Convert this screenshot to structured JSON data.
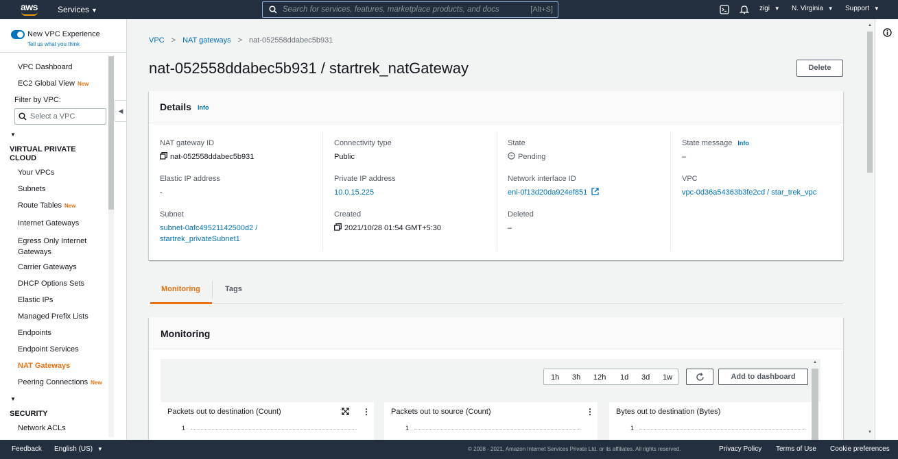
{
  "topnav": {
    "logo": "aws",
    "services_label": "Services",
    "search_placeholder": "Search for services, features, marketplace products, and docs",
    "search_shortcut": "[Alt+S]",
    "user": "zigi",
    "region": "N. Virginia",
    "support": "Support",
    "icons": [
      "cloudshell-icon",
      "bell-icon"
    ]
  },
  "sidenav": {
    "vpc_experience": "New VPC Experience",
    "vpc_experience_sub": "Tell us what you think",
    "top_items": [
      {
        "label": "VPC Dashboard"
      },
      {
        "label": "EC2 Global View",
        "badge": "New"
      }
    ],
    "filter_label": "Filter by VPC:",
    "filter_placeholder": "Select a VPC",
    "section_vpc": "VIRTUAL PRIVATE CLOUD",
    "vpc_items": [
      {
        "label": "Your VPCs"
      },
      {
        "label": "Subnets"
      },
      {
        "label": "Route Tables",
        "badge": "New"
      },
      {
        "label": "Internet Gateways"
      },
      {
        "label": "Egress Only Internet Gateways"
      },
      {
        "label": "Carrier Gateways"
      },
      {
        "label": "DHCP Options Sets"
      },
      {
        "label": "Elastic IPs"
      },
      {
        "label": "Managed Prefix Lists"
      },
      {
        "label": "Endpoints"
      },
      {
        "label": "Endpoint Services"
      },
      {
        "label": "NAT Gateways",
        "active": true
      },
      {
        "label": "Peering Connections",
        "badge": "New"
      }
    ],
    "section_security": "SECURITY",
    "security_items": [
      {
        "label": "Network ACLs"
      }
    ]
  },
  "breadcrumb": {
    "items": [
      "VPC",
      "NAT gateways"
    ],
    "current": "nat-052558ddabec5b931"
  },
  "page": {
    "title": "nat-052558ddabec5b931 / startrek_natGateway",
    "delete_label": "Delete"
  },
  "details": {
    "heading": "Details",
    "info": "Info",
    "nat_gateway_id_label": "NAT gateway ID",
    "nat_gateway_id": "nat-052558ddabec5b931",
    "elastic_ip_label": "Elastic IP address",
    "elastic_ip": "-",
    "subnet_label": "Subnet",
    "subnet_line1": "subnet-0afc49521142500d2 /",
    "subnet_line2": "startrek_privateSubnet1",
    "connectivity_label": "Connectivity type",
    "connectivity": "Public",
    "private_ip_label": "Private IP address",
    "private_ip": "10.0.15.225",
    "created_label": "Created",
    "created": "2021/10/28 01:54 GMT+5:30",
    "state_label": "State",
    "state": "Pending",
    "eni_label": "Network interface ID",
    "eni": "eni-0f13d20da924ef851",
    "deleted_label": "Deleted",
    "deleted": "–",
    "state_message_label": "State message",
    "state_message_info": "Info",
    "state_message": "–",
    "vpc_label": "VPC",
    "vpc": "vpc-0d36a54363b3fe2cd / star_trek_vpc"
  },
  "tabs": [
    {
      "label": "Monitoring",
      "active": true
    },
    {
      "label": "Tags"
    }
  ],
  "monitoring": {
    "heading": "Monitoring",
    "ranges": [
      "1h",
      "3h",
      "12h",
      "1d",
      "3d",
      "1w"
    ],
    "add_dashboard": "Add to dashboard",
    "widgets": [
      {
        "title": "Packets out to destination (Count)",
        "tick": "1"
      },
      {
        "title": "Packets out to source (Count)",
        "tick": "1"
      },
      {
        "title": "Bytes out to destination (Bytes)",
        "tick": "1"
      }
    ]
  },
  "footer": {
    "feedback": "Feedback",
    "language": "English (US)",
    "copyright": "© 2008 - 2021, Amazon Internet Services Private Ltd. or its affiliates. All rights reserved.",
    "privacy": "Privacy Policy",
    "terms": "Terms of Use",
    "cookies": "Cookie preferences"
  }
}
